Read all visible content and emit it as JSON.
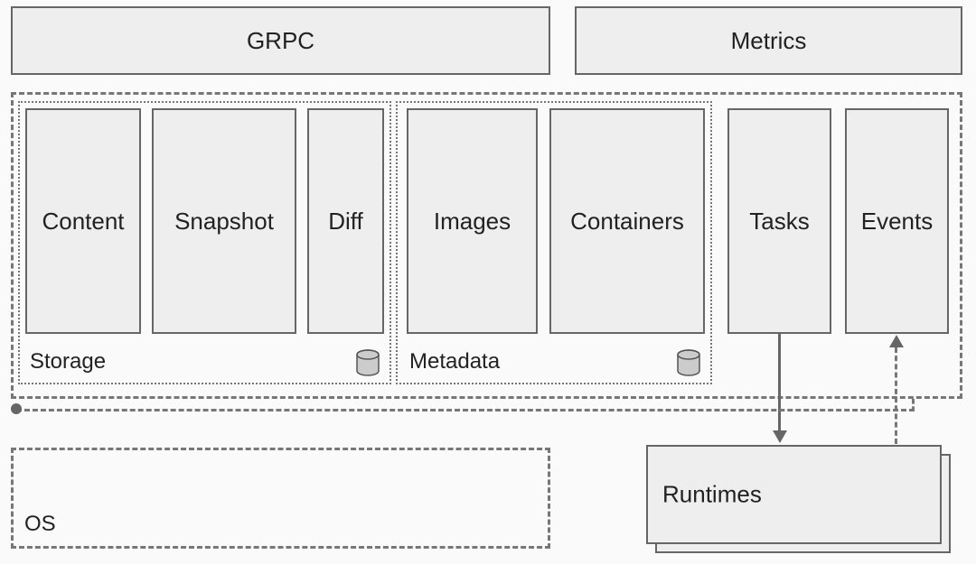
{
  "top": {
    "grpc": "GRPC",
    "metrics": "Metrics"
  },
  "services": {
    "content": "Content",
    "snapshot": "Snapshot",
    "diff": "Diff",
    "images": "Images",
    "containers": "Containers",
    "tasks": "Tasks",
    "events": "Events"
  },
  "groups": {
    "storage": "Storage",
    "metadata": "Metadata"
  },
  "os": "OS",
  "runtimes": "Runtimes"
}
